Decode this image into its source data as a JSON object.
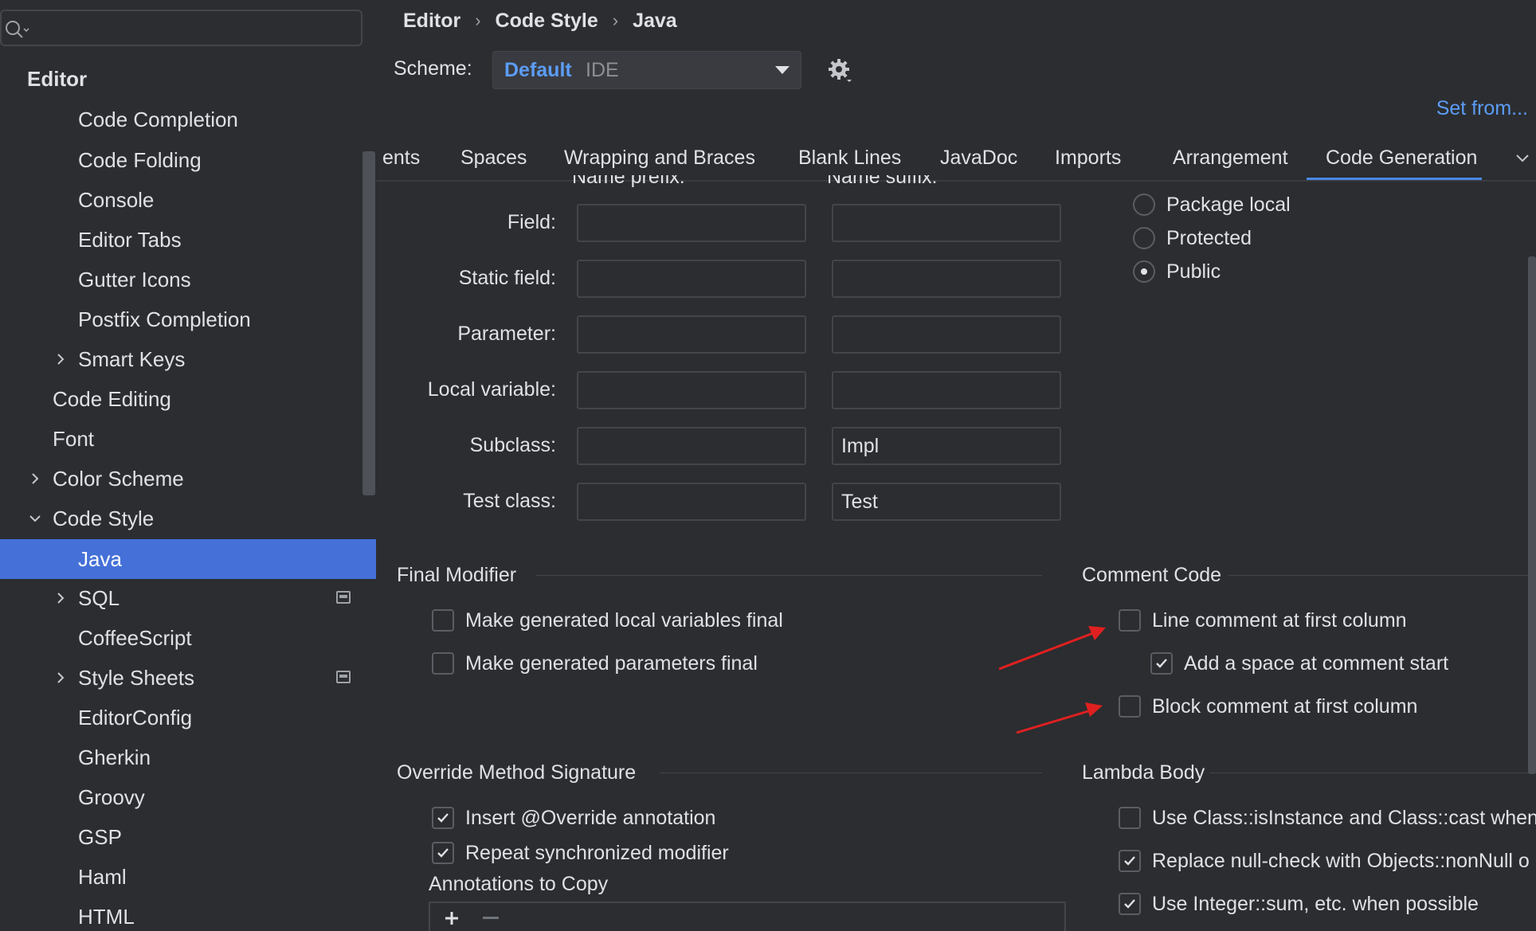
{
  "search": {
    "placeholder": ""
  },
  "sidebar": {
    "items": [
      {
        "label": "Editor"
      },
      {
        "label": "Code Completion"
      },
      {
        "label": "Code Folding"
      },
      {
        "label": "Console"
      },
      {
        "label": "Editor Tabs"
      },
      {
        "label": "Gutter Icons"
      },
      {
        "label": "Postfix Completion"
      },
      {
        "label": "Smart Keys"
      },
      {
        "label": "Code Editing"
      },
      {
        "label": "Font"
      },
      {
        "label": "Color Scheme"
      },
      {
        "label": "Code Style"
      },
      {
        "label": "Java"
      },
      {
        "label": "SQL"
      },
      {
        "label": "CoffeeScript"
      },
      {
        "label": "Style Sheets"
      },
      {
        "label": "EditorConfig"
      },
      {
        "label": "Gherkin"
      },
      {
        "label": "Groovy"
      },
      {
        "label": "GSP"
      },
      {
        "label": "Haml"
      },
      {
        "label": "HTML"
      }
    ]
  },
  "breadcrumb": {
    "items": [
      "Editor",
      "Code Style",
      "Java"
    ],
    "separator": "›"
  },
  "scheme": {
    "label": "Scheme:",
    "value": "Default",
    "suffix": "IDE"
  },
  "set_from": "Set from...",
  "tabs": [
    "ents",
    "Spaces",
    "Wrapping and Braces",
    "Blank Lines",
    "JavaDoc",
    "Imports",
    "Arrangement",
    "Code Generation"
  ],
  "active_tab": "Code Generation",
  "naming": {
    "col_prefix": "Name prefix:",
    "col_suffix": "Name suffix:",
    "rows": [
      {
        "label": "Field:",
        "prefix": "",
        "suffix": ""
      },
      {
        "label": "Static field:",
        "prefix": "",
        "suffix": ""
      },
      {
        "label": "Parameter:",
        "prefix": "",
        "suffix": ""
      },
      {
        "label": "Local variable:",
        "prefix": "",
        "suffix": ""
      },
      {
        "label": "Subclass:",
        "prefix": "",
        "suffix": "Impl"
      },
      {
        "label": "Test class:",
        "prefix": "",
        "suffix": "Test"
      }
    ]
  },
  "visibility": {
    "options": [
      {
        "label": "Package local",
        "checked": false
      },
      {
        "label": "Protected",
        "checked": false
      },
      {
        "label": "Public",
        "checked": true
      }
    ]
  },
  "final_modifier": {
    "title": "Final Modifier",
    "options": [
      {
        "label": "Make generated local variables final",
        "checked": false
      },
      {
        "label": "Make generated parameters final",
        "checked": false
      }
    ]
  },
  "comment_code": {
    "title": "Comment Code",
    "options": [
      {
        "label": "Line comment at first column",
        "checked": false
      },
      {
        "label": "Add a space at comment start",
        "checked": true
      },
      {
        "label": "Block comment at first column",
        "checked": false
      }
    ]
  },
  "override": {
    "title": "Override Method Signature",
    "options": [
      {
        "label": "Insert @Override annotation",
        "checked": true
      },
      {
        "label": "Repeat synchronized modifier",
        "checked": true
      }
    ],
    "annotations_label": "Annotations to Copy"
  },
  "lambda": {
    "title": "Lambda Body",
    "options": [
      {
        "label": "Use Class::isInstance and Class::cast when p",
        "checked": false
      },
      {
        "label": "Replace null-check with Objects::nonNull o",
        "checked": true
      },
      {
        "label": "Use Integer::sum, etc. when possible",
        "checked": true
      }
    ]
  },
  "colors": {
    "accent": "#4470d8",
    "link": "#5c9cf5",
    "arrow": "#e02020"
  }
}
